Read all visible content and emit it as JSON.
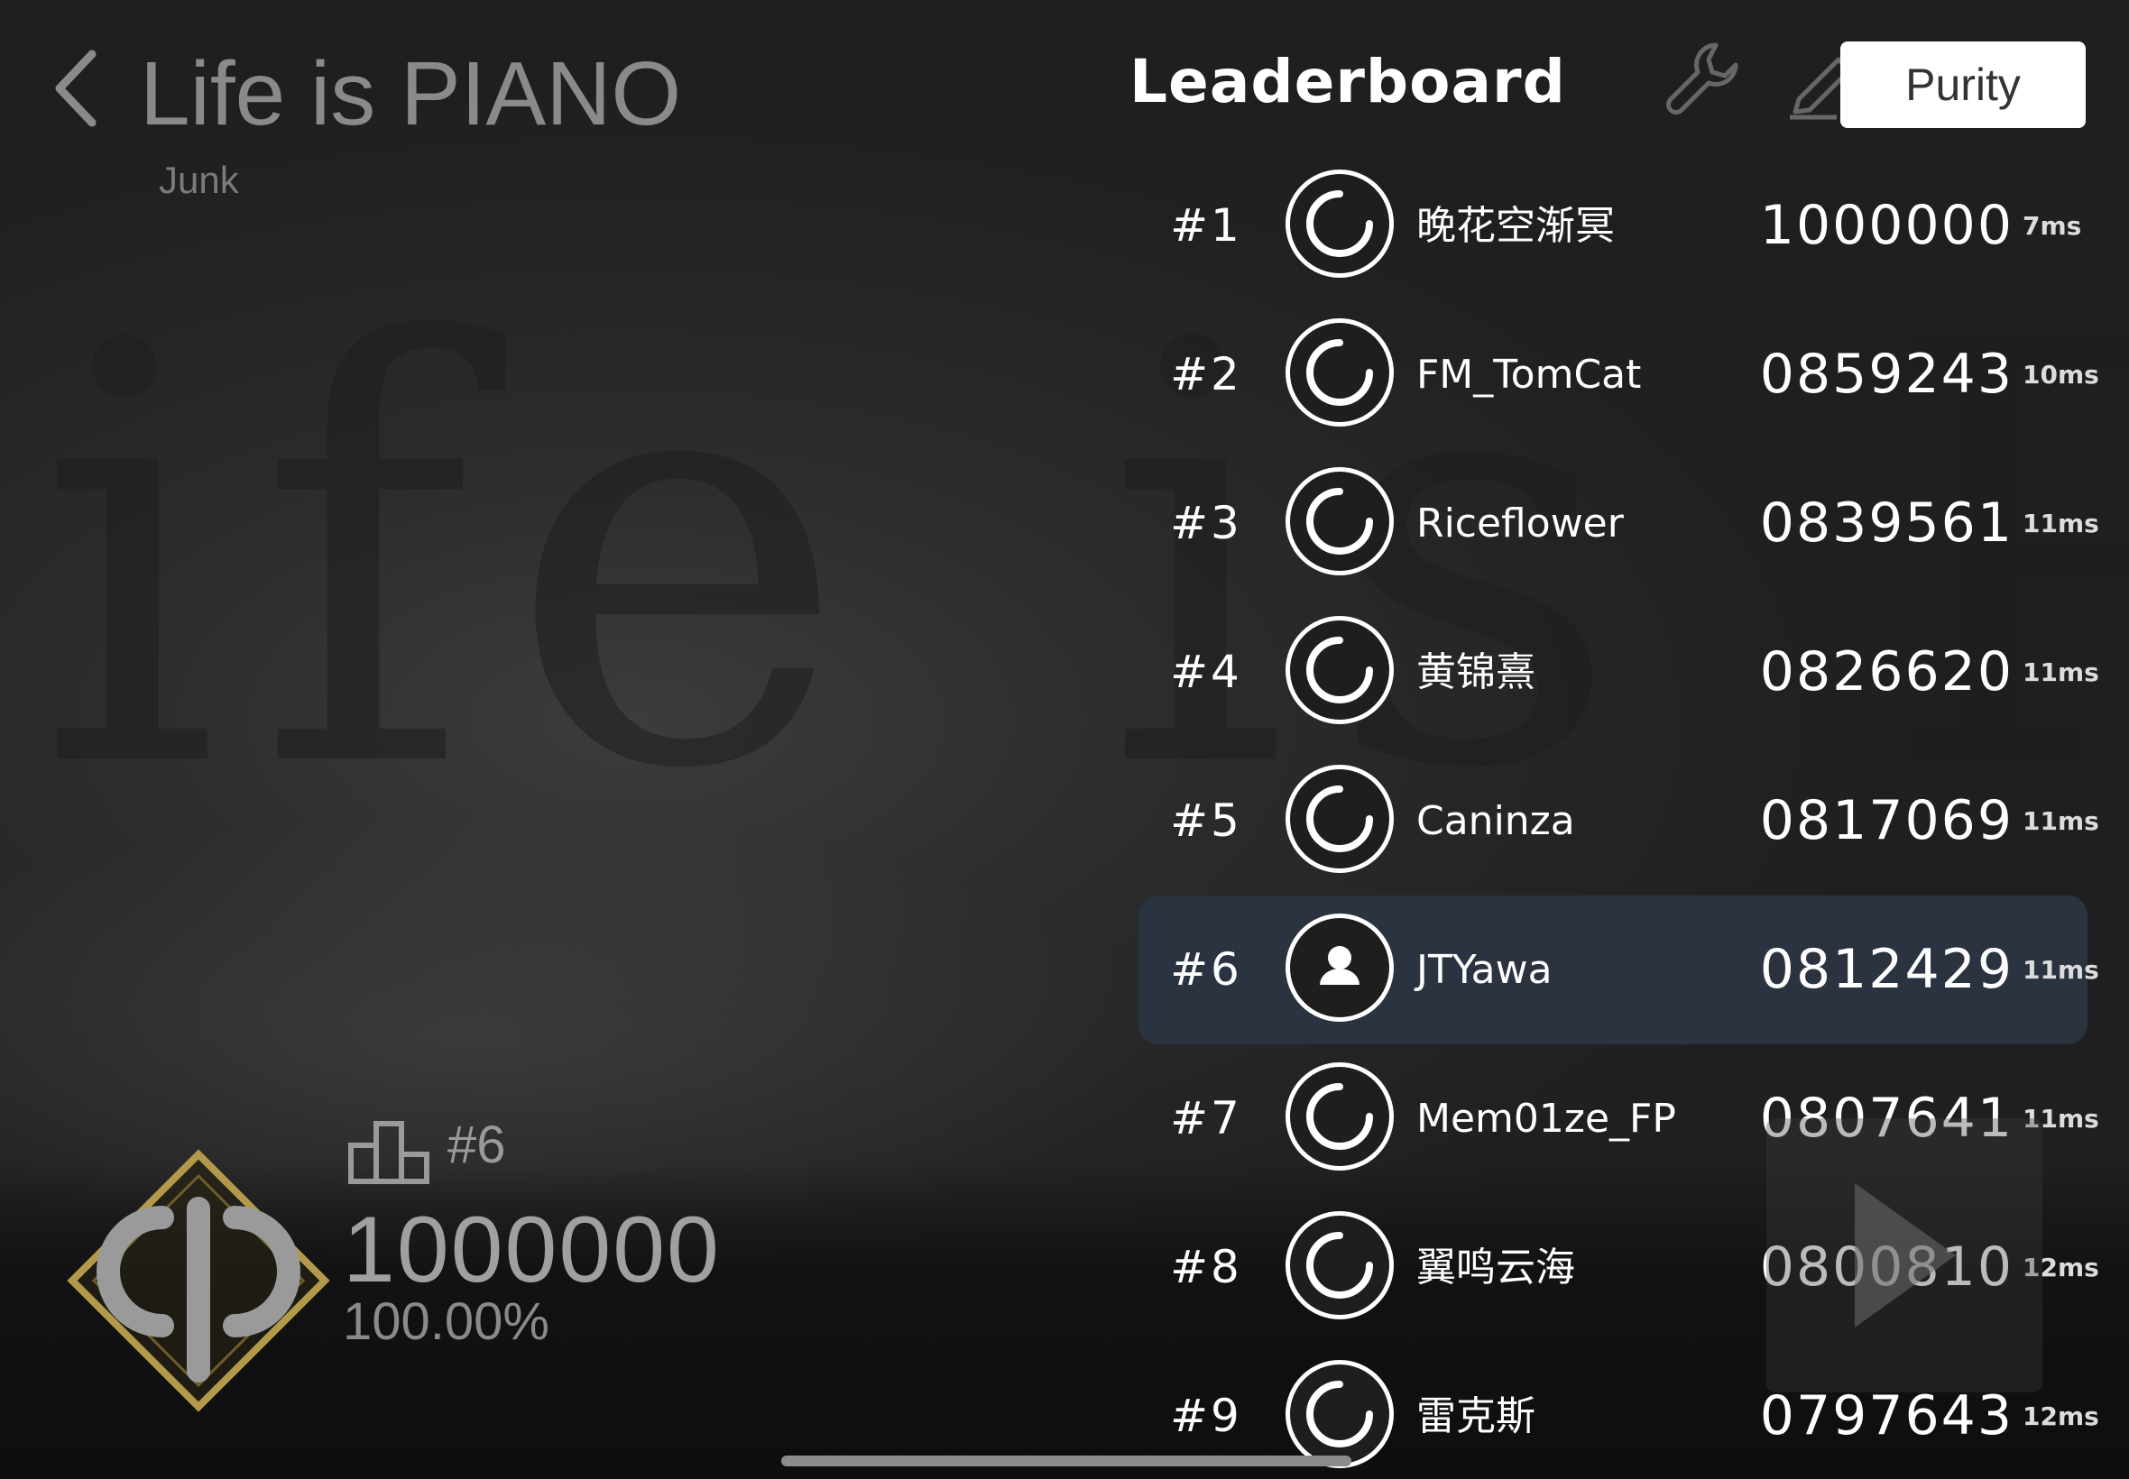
{
  "song": {
    "title": "Life is PIANO",
    "artist": "Junk"
  },
  "header": {
    "leaderboard_title": "Leaderboard",
    "mode_label": "Purity",
    "icons": [
      "back-chevron-icon",
      "wrench-icon",
      "pen-icon"
    ]
  },
  "leaderboard": [
    {
      "rank": "#1",
      "name": "晚花空渐冥",
      "score": "1000000",
      "ms": "7ms",
      "self": false
    },
    {
      "rank": "#2",
      "name": "FM_TomCat",
      "score": "0859243",
      "ms": "10ms",
      "self": false
    },
    {
      "rank": "#3",
      "name": "Riceflower",
      "score": "0839561",
      "ms": "11ms",
      "self": false
    },
    {
      "rank": "#4",
      "name": "黄锦熹",
      "score": "0826620",
      "ms": "11ms",
      "self": false
    },
    {
      "rank": "#5",
      "name": "Caninza",
      "score": "0817069",
      "ms": "11ms",
      "self": false
    },
    {
      "rank": "#6",
      "name": "JTYawa",
      "score": "0812429",
      "ms": "11ms",
      "self": true
    },
    {
      "rank": "#7",
      "name": "Mem01ze_FP",
      "score": "0807641",
      "ms": "11ms",
      "self": false
    },
    {
      "rank": "#8",
      "name": "翼鸣云海",
      "score": "0800810",
      "ms": "12ms",
      "self": false
    },
    {
      "rank": "#9",
      "name": "雷克斯",
      "score": "0797643",
      "ms": "12ms",
      "self": false
    }
  ],
  "personal": {
    "rank": "#6",
    "score": "1000000",
    "accuracy": "100.00%",
    "badge": "phi-grade-badge"
  },
  "colors": {
    "self_row_bg": "#2b3340",
    "badge_gold": "#b39a4a"
  }
}
